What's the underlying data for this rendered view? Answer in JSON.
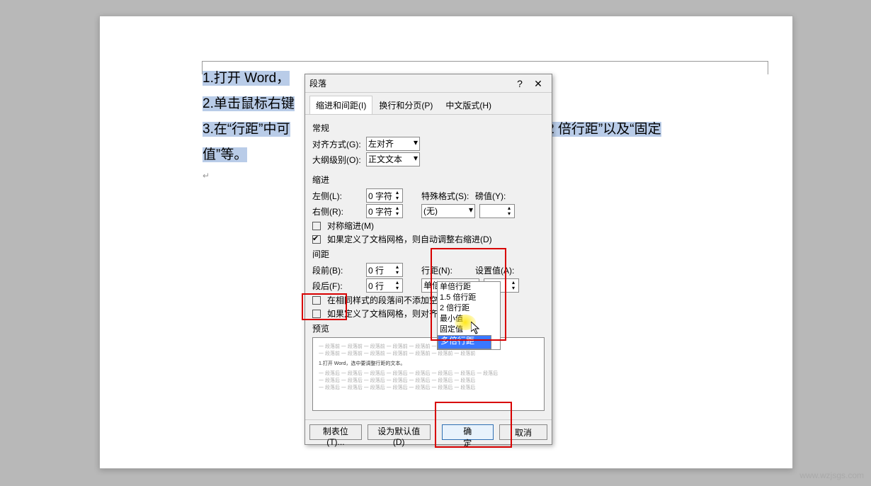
{
  "doc": {
    "l1": "1.打开 Word，",
    "l2": "2.单击鼠标右键",
    "l3a": "3.在“行距”中可",
    "l3b": "2 倍行距”以及“固定值”等。",
    "cursor": "↵"
  },
  "dialog": {
    "title": "段落",
    "help": "?",
    "close": "✕",
    "tabs": {
      "t1": "缩进和间距(I)",
      "t2": "换行和分页(P)",
      "t3": "中文版式(H)"
    },
    "general": "常规",
    "align_lbl": "对齐方式(G):",
    "align_val": "左对齐",
    "outline_lbl": "大纲级别(O):",
    "outline_val": "正文文本",
    "indent": "缩进",
    "left_lbl": "左侧(L):",
    "left_val": "0 字符",
    "right_lbl": "右侧(R):",
    "right_val": "0 字符",
    "special_lbl": "特殊格式(S):",
    "special_val": "(无)",
    "by_lbl": "磅值(Y):",
    "mirror": "对称缩进(M)",
    "grid_indent": "如果定义了文档网格，则自动调整右缩进(D)",
    "spacing": "间距",
    "before_lbl": "段前(B):",
    "before_val": "0 行",
    "after_lbl": "段后(F):",
    "after_val": "0 行",
    "linespace_lbl": "行距(N):",
    "linespace_val": "单倍行距",
    "setat_lbl": "设置值(A):",
    "nospace": "在相同样式的段落间不添加空格",
    "grid_align": "如果定义了文档网格，则对齐到",
    "preview": "预览",
    "pv_sample": "1.打开 Word，选中要调整行距的文本。",
    "tabs_btn": "制表位(T)...",
    "default_btn": "设为默认值(D)",
    "ok": "确定",
    "cancel": "取消"
  },
  "options": [
    "单倍行距",
    "1.5 倍行距",
    "2 倍行距",
    "最小值",
    "固定值",
    "多倍行距"
  ],
  "watermark": "www.wzjsgs.com"
}
